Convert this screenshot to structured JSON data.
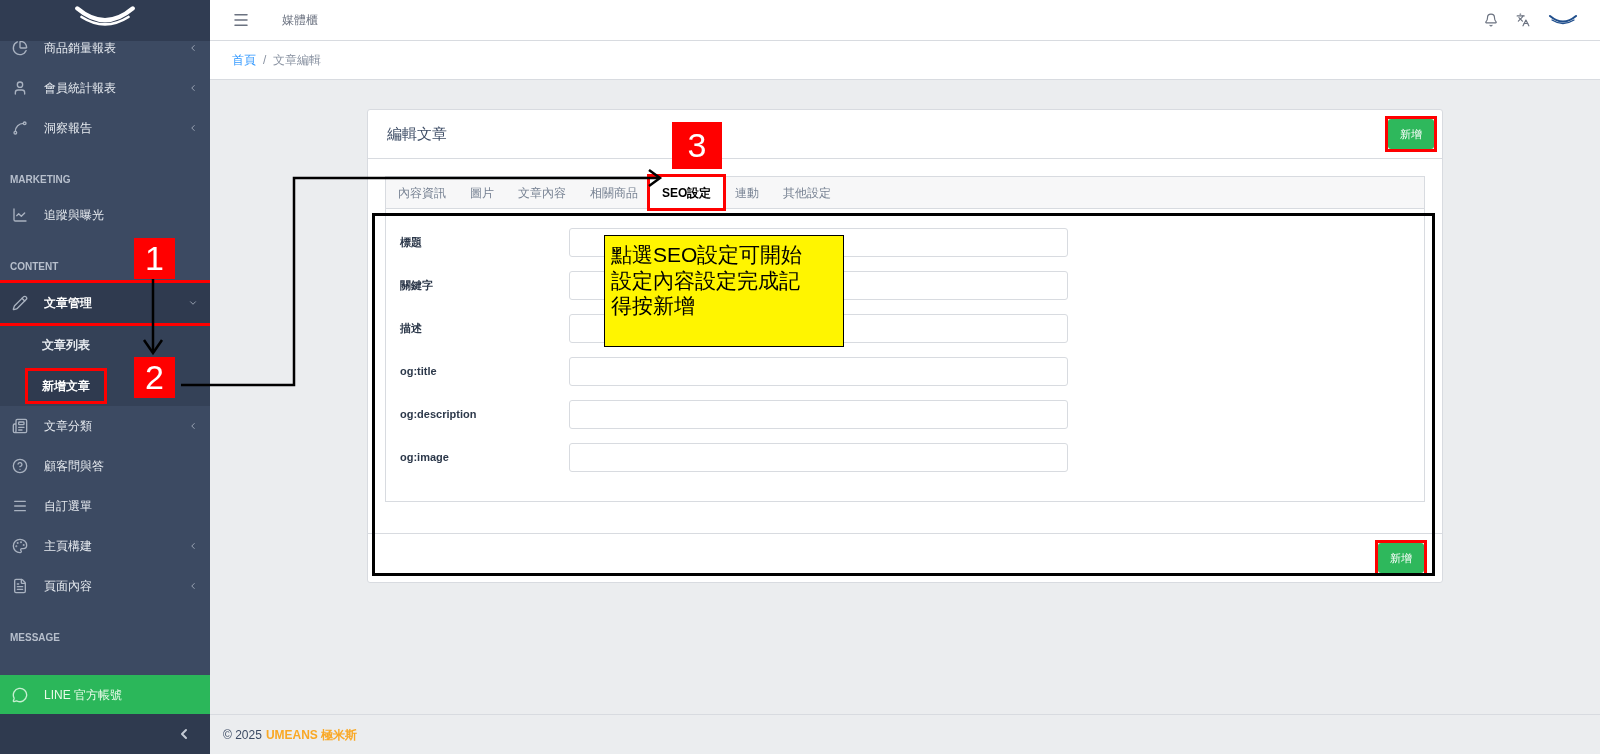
{
  "sidebar": {
    "sections": [
      {
        "items": [
          {
            "label": "商品銷量報表",
            "expandable": true,
            "expanded": false,
            "highlighted": false
          },
          {
            "label": "會員統計報表",
            "expandable": true,
            "expanded": false,
            "highlighted": false
          },
          {
            "label": "洞察報告",
            "expandable": true,
            "expanded": false,
            "highlighted": false
          }
        ]
      },
      {
        "title": "MARKETING",
        "items": [
          {
            "label": "追蹤與曝光",
            "expandable": false,
            "expanded": false,
            "highlighted": false
          }
        ]
      },
      {
        "title": "CONTENT",
        "items": [
          {
            "label": "文章管理",
            "expandable": true,
            "expanded": true,
            "highlighted": true,
            "children": [
              {
                "label": "文章列表",
                "selected": false,
                "highlighted": false
              },
              {
                "label": "新增文章",
                "selected": true,
                "highlighted": true
              }
            ]
          },
          {
            "label": "文章分類",
            "expandable": true,
            "expanded": false,
            "highlighted": false
          },
          {
            "label": "顧客問與答",
            "expandable": false,
            "expanded": false,
            "highlighted": false
          },
          {
            "label": "自訂選單",
            "expandable": false,
            "expanded": false,
            "highlighted": false
          },
          {
            "label": "主頁構建",
            "expandable": true,
            "expanded": false,
            "highlighted": false
          },
          {
            "label": "頁面內容",
            "expandable": true,
            "expanded": false,
            "highlighted": false
          }
        ]
      },
      {
        "title": "MESSAGE"
      }
    ],
    "line_button": {
      "label": "LINE 官方帳號"
    }
  },
  "topbar": {
    "title": "媒體櫃"
  },
  "breadcrumb": {
    "separator": "/",
    "items": [
      {
        "label": "首頁",
        "link": true
      },
      {
        "label": "文章編輯",
        "link": false
      }
    ]
  },
  "card": {
    "title": "編輯文章",
    "header_button": {
      "label": "新增",
      "highlighted": true
    },
    "tabs": [
      {
        "label": "內容資訊",
        "selected": false,
        "highlighted": false
      },
      {
        "label": "圖片",
        "selected": false,
        "highlighted": false
      },
      {
        "label": "文章內容",
        "selected": false,
        "highlighted": false
      },
      {
        "label": "相關商品",
        "selected": false,
        "highlighted": false
      },
      {
        "label": "SEO設定",
        "selected": true,
        "highlighted": true
      },
      {
        "label": "連動",
        "selected": false,
        "highlighted": false
      },
      {
        "label": "其他設定",
        "selected": false,
        "highlighted": false
      }
    ],
    "fields": [
      {
        "label": "標題"
      },
      {
        "label": "關鍵字"
      },
      {
        "label": "描述"
      },
      {
        "label": "og:title"
      },
      {
        "label": "og:description"
      },
      {
        "label": "og:image"
      }
    ],
    "footer_button": {
      "label": "新增",
      "highlighted": true
    }
  },
  "footer": {
    "copyright": "© 2025",
    "brand": "UMEANS 極米斯"
  },
  "annotations": {
    "markers": [
      "1",
      "2",
      "3"
    ],
    "callout": [
      "點選SEO設定可開始",
      "設定內容設定完成記",
      "得按新增"
    ]
  }
}
